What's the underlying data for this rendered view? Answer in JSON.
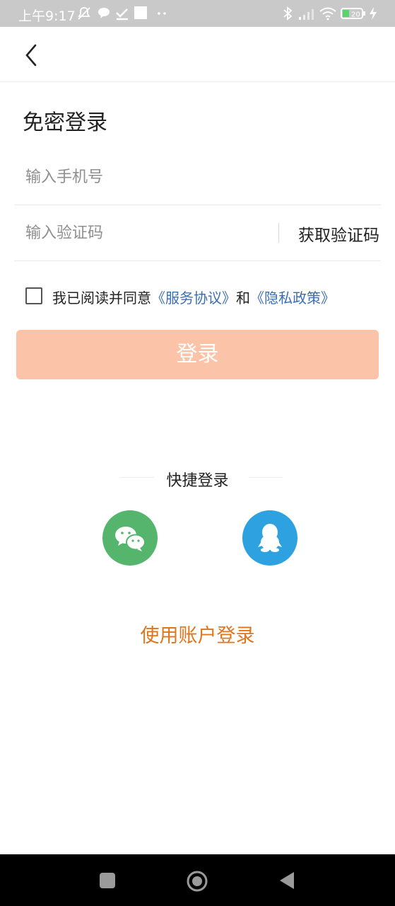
{
  "status_bar": {
    "time": "上午9:17",
    "icons": [
      "notification-muted-icon",
      "chat-bubble-icon",
      "download-check-icon",
      "square-icon",
      "dots-icon",
      "bluetooth-icon",
      "signal-icon",
      "wifi-icon",
      "battery-icon",
      "charging-icon"
    ],
    "battery_level": "20"
  },
  "header": {
    "back_icon": "chevron-left-icon"
  },
  "title": "免密登录",
  "phone_field": {
    "placeholder": "输入手机号",
    "value": ""
  },
  "code_field": {
    "placeholder": "输入验证码",
    "value": "",
    "get_code_label": "获取验证码"
  },
  "agreement": {
    "checked": false,
    "prefix": "我已阅读并同意",
    "service_link": "《服务协议》",
    "conjunction": "和",
    "privacy_link": "《隐私政策》"
  },
  "login_button": "登录",
  "quick_login": {
    "title": "快捷登录",
    "options": [
      {
        "icon": "wechat-icon",
        "color": "#56b56d"
      },
      {
        "icon": "qq-icon",
        "color": "#2ea2e0"
      }
    ]
  },
  "account_login": "使用账户登录",
  "colors": {
    "login_button_bg": "#fbc3a8",
    "link": "#3a6fb5",
    "account_login": "#e0751c"
  },
  "nav_bar": {
    "buttons": [
      "recents-square-icon",
      "home-circle-icon",
      "back-triangle-icon"
    ]
  }
}
